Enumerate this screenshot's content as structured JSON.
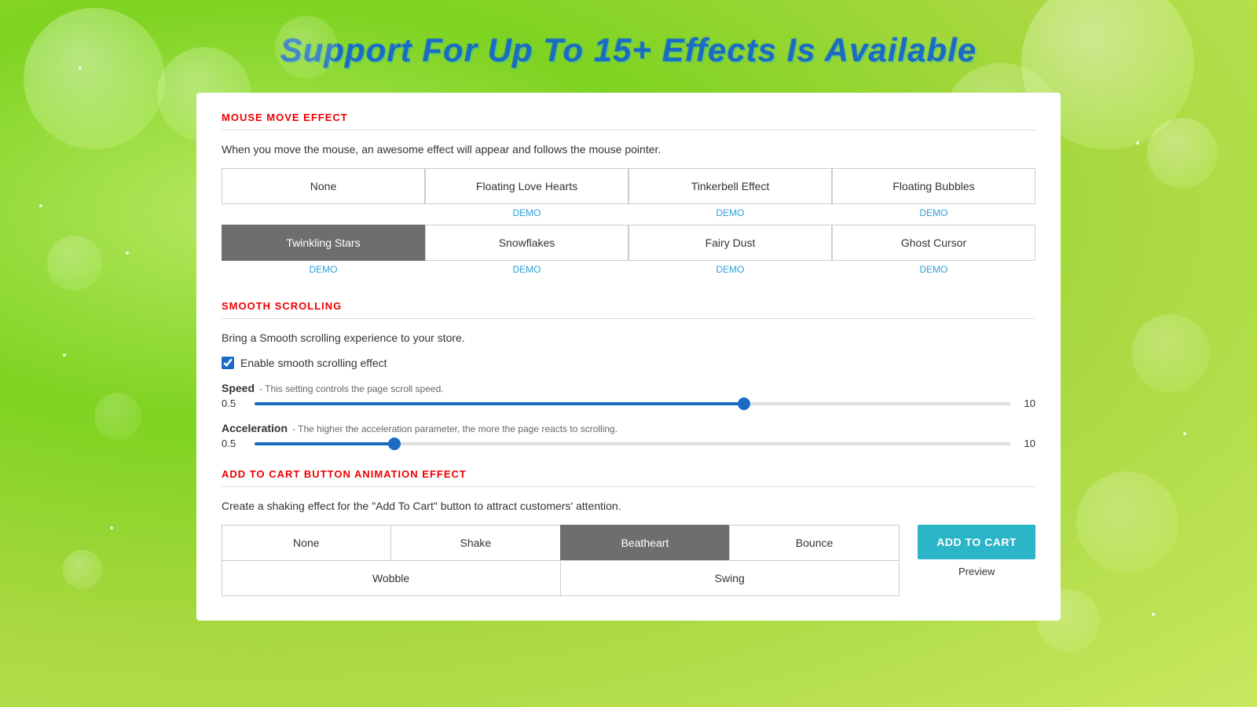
{
  "page": {
    "title": "Support For Up To 15+ Effects Is Available"
  },
  "mouseMoveSection": {
    "title": "MOUSE MOVE EFFECT",
    "description": "When you move the mouse, an awesome effect will appear and follows the mouse pointer.",
    "effects_row1": [
      {
        "id": "none",
        "label": "None",
        "active": false,
        "showDemo": false
      },
      {
        "id": "floating-love-hearts",
        "label": "Floating Love Hearts",
        "active": false,
        "showDemo": true,
        "demoLabel": "DEMO"
      },
      {
        "id": "tinkerbell-effect",
        "label": "Tinkerbell Effect",
        "active": false,
        "showDemo": true,
        "demoLabel": "DEMO"
      },
      {
        "id": "floating-bubbles",
        "label": "Floating Bubbles",
        "active": false,
        "showDemo": true,
        "demoLabel": "DEMO"
      }
    ],
    "effects_row2": [
      {
        "id": "twinkling-stars",
        "label": "Twinkling Stars",
        "active": true,
        "showDemo": true,
        "demoLabel": "DEMO"
      },
      {
        "id": "snowflakes",
        "label": "Snowflakes",
        "active": false,
        "showDemo": true,
        "demoLabel": "DEMO"
      },
      {
        "id": "fairy-dust",
        "label": "Fairy Dust",
        "active": false,
        "showDemo": true,
        "demoLabel": "DEMO"
      },
      {
        "id": "ghost-cursor",
        "label": "Ghost Cursor",
        "active": false,
        "showDemo": true,
        "demoLabel": "DEMO"
      }
    ]
  },
  "smoothScrollingSection": {
    "title": "SMOOTH SCROLLING",
    "description": "Bring a Smooth scrolling experience to your store.",
    "checkboxLabel": "Enable smooth scrolling effect",
    "checked": true,
    "speedLabel": "Speed",
    "speedDesc": "- This setting controls the page scroll speed.",
    "speedMin": "0.5",
    "speedMax": "10",
    "speedValue": 65,
    "accelLabel": "Acceleration",
    "accelDesc": "- The higher the acceleration parameter, the more the page reacts to scrolling.",
    "accelMin": "0.5",
    "accelMax": "10",
    "accelValue": 18
  },
  "cartSection": {
    "title": "ADD TO CART BUTTON ANIMATION EFFECT",
    "description": "Create a shaking effect for the \"Add To Cart\" button to attract customers' attention.",
    "effects_row1": [
      {
        "id": "none",
        "label": "None",
        "active": false
      },
      {
        "id": "shake",
        "label": "Shake",
        "active": false
      },
      {
        "id": "beatheart",
        "label": "Beatheart",
        "active": true
      },
      {
        "id": "bounce",
        "label": "Bounce",
        "active": false
      }
    ],
    "effects_row2": [
      {
        "id": "wobble",
        "label": "Wobble",
        "active": false
      },
      {
        "id": "swing",
        "label": "Swing",
        "active": false
      }
    ],
    "addToCartLabel": "ADD TO CART",
    "previewLabel": "Preview"
  }
}
